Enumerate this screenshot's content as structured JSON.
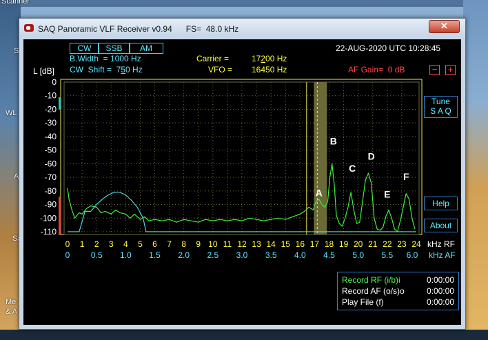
{
  "desktop": {
    "labels": [
      "Scanner",
      "S",
      "WL",
      "A",
      "Sa",
      "Me",
      "& A"
    ]
  },
  "window": {
    "title": "SAQ Panoramic VLF Receiver v0.94      FS=  48.0 kHz",
    "close_label": "✕"
  },
  "modes": [
    "CW",
    "SSB",
    "AM"
  ],
  "params": {
    "bandwidth": "B.Width  = 1000 Hz",
    "shift_prefix": "CW  Shift =  7",
    "shift_digit": "5",
    "shift_suffix": "0 Hz",
    "carrier_label": "Carrier =",
    "carrier_prefix": "17",
    "carrier_digit": "2",
    "carrier_suffix": "00 Hz",
    "vfo_label": "VFO =",
    "vfo_value": "16450 Hz",
    "datetime": "22-AUG-2020 UTC 10:28:45",
    "af_gain": "AF Gain=  0 dB",
    "minus": "−",
    "plus": "+"
  },
  "buttons": {
    "tune_line1": "Tune",
    "tune_line2": "S A Q",
    "help": "Help",
    "about": "About"
  },
  "record": {
    "rows": [
      {
        "label": "Record  RF (i/b)i",
        "value": "0:00:00"
      },
      {
        "label": "Record  AF (o/s)o",
        "value": "0:00:00"
      },
      {
        "label": "Play File (f)",
        "value": "0:00:00"
      }
    ]
  },
  "chart_data": {
    "type": "line",
    "ylabel": "L [dB]",
    "ylim": [
      -110,
      0
    ],
    "yticks": [
      "0",
      "-10",
      "-20",
      "-30",
      "-40",
      "-50",
      "-60",
      "-70",
      "-80",
      "-90",
      "-100",
      "-110"
    ],
    "xlim": [
      0,
      24
    ],
    "xticks_rf": [
      "0",
      "1",
      "2",
      "3",
      "4",
      "5",
      "6",
      "7",
      "8",
      "9",
      "10",
      "11",
      "12",
      "13",
      "14",
      "15",
      "16",
      "17",
      "18",
      "19",
      "20",
      "21",
      "22",
      "23",
      "24"
    ],
    "xunit_rf": "kHz RF",
    "xticks_af": [
      "0",
      "0.5",
      "1.0",
      "1.5",
      "2.0",
      "2.5",
      "3.0",
      "3.5",
      "4.0",
      "4.5",
      "5.0",
      "5.5",
      "6.0"
    ],
    "xunit_af": "kHz AF",
    "annotations": [
      {
        "label": "A",
        "x": 17.3,
        "y": -84
      },
      {
        "label": "B",
        "x": 18.3,
        "y": -46
      },
      {
        "label": "C",
        "x": 19.6,
        "y": -66
      },
      {
        "label": "D",
        "x": 20.9,
        "y": -57
      },
      {
        "label": "E",
        "x": 22.0,
        "y": -85
      },
      {
        "label": "F",
        "x": 23.3,
        "y": -72
      }
    ],
    "passband_rf": [
      16.95,
      17.85
    ],
    "carrier_khz": 16.45,
    "series": [
      {
        "color": "#3fef3f",
        "x": [
          0.0,
          0.1,
          0.2,
          0.3,
          0.5,
          0.8,
          1.0,
          1.3,
          1.6,
          2.0,
          2.3,
          2.6,
          3.0,
          3.3,
          3.6,
          4.0,
          4.3,
          4.6,
          5.0,
          5.3,
          5.6,
          6.0,
          6.5,
          7.0,
          7.5,
          8.0,
          8.5,
          9.0,
          9.5,
          10.0,
          10.5,
          11.0,
          11.5,
          12.0,
          12.5,
          13.0,
          13.5,
          14.0,
          14.5,
          15.0,
          15.5,
          16.0,
          16.3,
          16.6,
          16.9,
          17.1,
          17.3,
          17.5,
          17.7,
          17.9,
          18.05,
          18.2,
          18.35,
          18.5,
          18.7,
          18.9,
          19.1,
          19.3,
          19.5,
          19.7,
          19.9,
          20.1,
          20.3,
          20.5,
          20.7,
          20.9,
          21.1,
          21.3,
          21.5,
          21.7,
          21.9,
          22.1,
          22.3,
          22.5,
          22.7,
          22.9,
          23.1,
          23.3,
          23.5,
          23.7,
          23.9
        ],
        "y": [
          -78,
          -86,
          -90,
          -94,
          -100,
          -96,
          -97,
          -93,
          -91,
          -92,
          -96,
          -95,
          -97,
          -94,
          -96,
          -97,
          -100,
          -97,
          -101,
          -99,
          -102,
          -101,
          -102,
          -101,
          -103,
          -101,
          -102,
          -103,
          -101,
          -102,
          -101,
          -102,
          -101,
          -102,
          -100,
          -101,
          -102,
          -101,
          -100,
          -101,
          -99,
          -97,
          -95,
          -92,
          -94,
          -88,
          -86,
          -90,
          -92,
          -88,
          -70,
          -60,
          -75,
          -98,
          -104,
          -106,
          -100,
          -92,
          -81,
          -94,
          -104,
          -103,
          -88,
          -72,
          -67,
          -74,
          -100,
          -108,
          -109,
          -107,
          -99,
          -94,
          -100,
          -108,
          -110,
          -102,
          -92,
          -82,
          -86,
          -100,
          -108
        ]
      },
      {
        "color": "#4ad6e8",
        "x": [
          0.0,
          0.3,
          0.8,
          1.2,
          1.6,
          2.0,
          2.4,
          2.8,
          3.2,
          3.6,
          4.0,
          4.4,
          4.8,
          5.2,
          5.4,
          5.6,
          24.0
        ],
        "y": [
          -110,
          -110,
          -110,
          -95,
          -95,
          -90,
          -86,
          -83,
          -81,
          -81,
          -83,
          -87,
          -92,
          -100,
          -110,
          -110,
          -110
        ]
      }
    ]
  }
}
